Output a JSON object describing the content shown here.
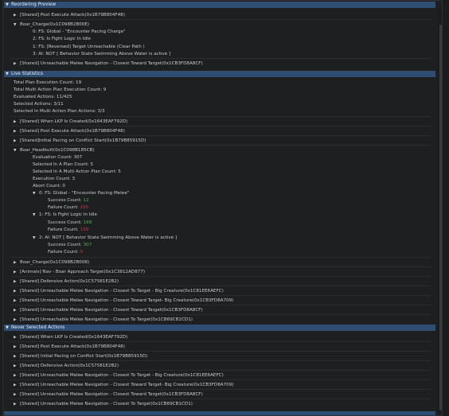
{
  "sections": {
    "reordering": "Reordering Preview",
    "live": "Live Statistics",
    "never": "Never Selected Actions"
  },
  "reordering": {
    "row1": "[Shared] Post Execute Attack(0x1B79B804F48)",
    "boar_charge": "Boar_Charge(0x1C098B2B00E)",
    "p0": "0: FS: Global - \"Encounter Pacing Charge\"",
    "p1": "2: FS: Is Fight Logic In Idle",
    "p2": "1: FS: [Reversed] Target Unreachable (Clear Path )",
    "p3": "3: AI: NOT [ Behavior State Swimming Above Water is active ]",
    "row3": "[Shared] Unreachable Melee Navigation - Closest Toward Target(0x1CB3FD8A8CF)"
  },
  "stats": {
    "s1": "Total Plan Execution Count: 19",
    "s2": "Total Multi Action Plan Execution Count: 9",
    "s3": "Evaluated Actions: 11/425",
    "s4": "Selected Actions: 3/11",
    "s5": "Selected In Multi Action Plan Actions: 3/3"
  },
  "live_list": [
    "[Shared] When LKP Is Created(0x1643EAF792D)",
    "[Shared] Post Execute Attack(0x1B79B804F48)",
    "[Shared]Initial Pacing on Conflict Start(0x1B79B85915D)"
  ],
  "headbutt": {
    "title": "Boar_Headbutt(0x1C098B185CB)",
    "eval": "Evaluation Count: 307",
    "sel_plan": "Selected In A Plan Count: 5",
    "sel_multi": "Selected In A Multi Action Plan Count: 5",
    "exec": "Execution Count: 3",
    "abort": "Abort Count: 0",
    "c0": "0: FS: Global - \"Encounter Pacing Melee\"",
    "c0_success": "12",
    "c0_failure": "295",
    "c1": "1: FS: Is Fight Logic In Idle",
    "c1_success": "168",
    "c1_failure": "139",
    "c2": "2: AI: NOT [ Behavior State Swimming Above Water is active ]",
    "c2_success": "307",
    "c2_failure": "0",
    "success_label": "Success Count:",
    "failure_label": "Failure Count:"
  },
  "live_list2": [
    "Boar_Charge(0x1C098B2B008)",
    "[Animals] Nav - Boar Approach Target(0x1C3812AD877)",
    "[Shared] Defensive Action(0x1C57581E2B2)",
    "[Shared] Unreachable Melee Navigation - Closest To Target - Big Creature(0x1C81EE6AEFC)",
    "[Shared] Unreachable Melee Navigation - Closest Toward Target- Big Creature(0x1CB3FD8A709)",
    "[Shared] Unreachable Melee Navigation - Closest Toward Target(0x1CB3FD8A8CF)",
    "[Shared] Unreachable Melee Navigation - Closest To Target(0x1CB69CB1CD1)"
  ],
  "never_list": [
    "[Shared] When LKP Is Created(0x1643EAF792D)",
    "[Shared] Post Execute Attack(0x1B79B804F48)",
    "[Shared] Initial Pacing on Conflict Start(0x1B79B85915D)",
    "[Shared] Defensive Action(0x1C57581E2B2)",
    "[Shared] Unreachable Melee Navigation - Closest To Target - Big Creature(0x1C81EE6AEFC)",
    "[Shared] Unreachable Melee Navigation - Closest Toward Target- Big Creature(0x1CB3FD8A709)",
    "[Shared] Unreachable Melee Navigation - Closest Toward Target(0x1CB3FD8A8CF)",
    "[Shared] Unreachable Melee Navigation - Closest To Target(0x1CB69CB1CD1)"
  ]
}
